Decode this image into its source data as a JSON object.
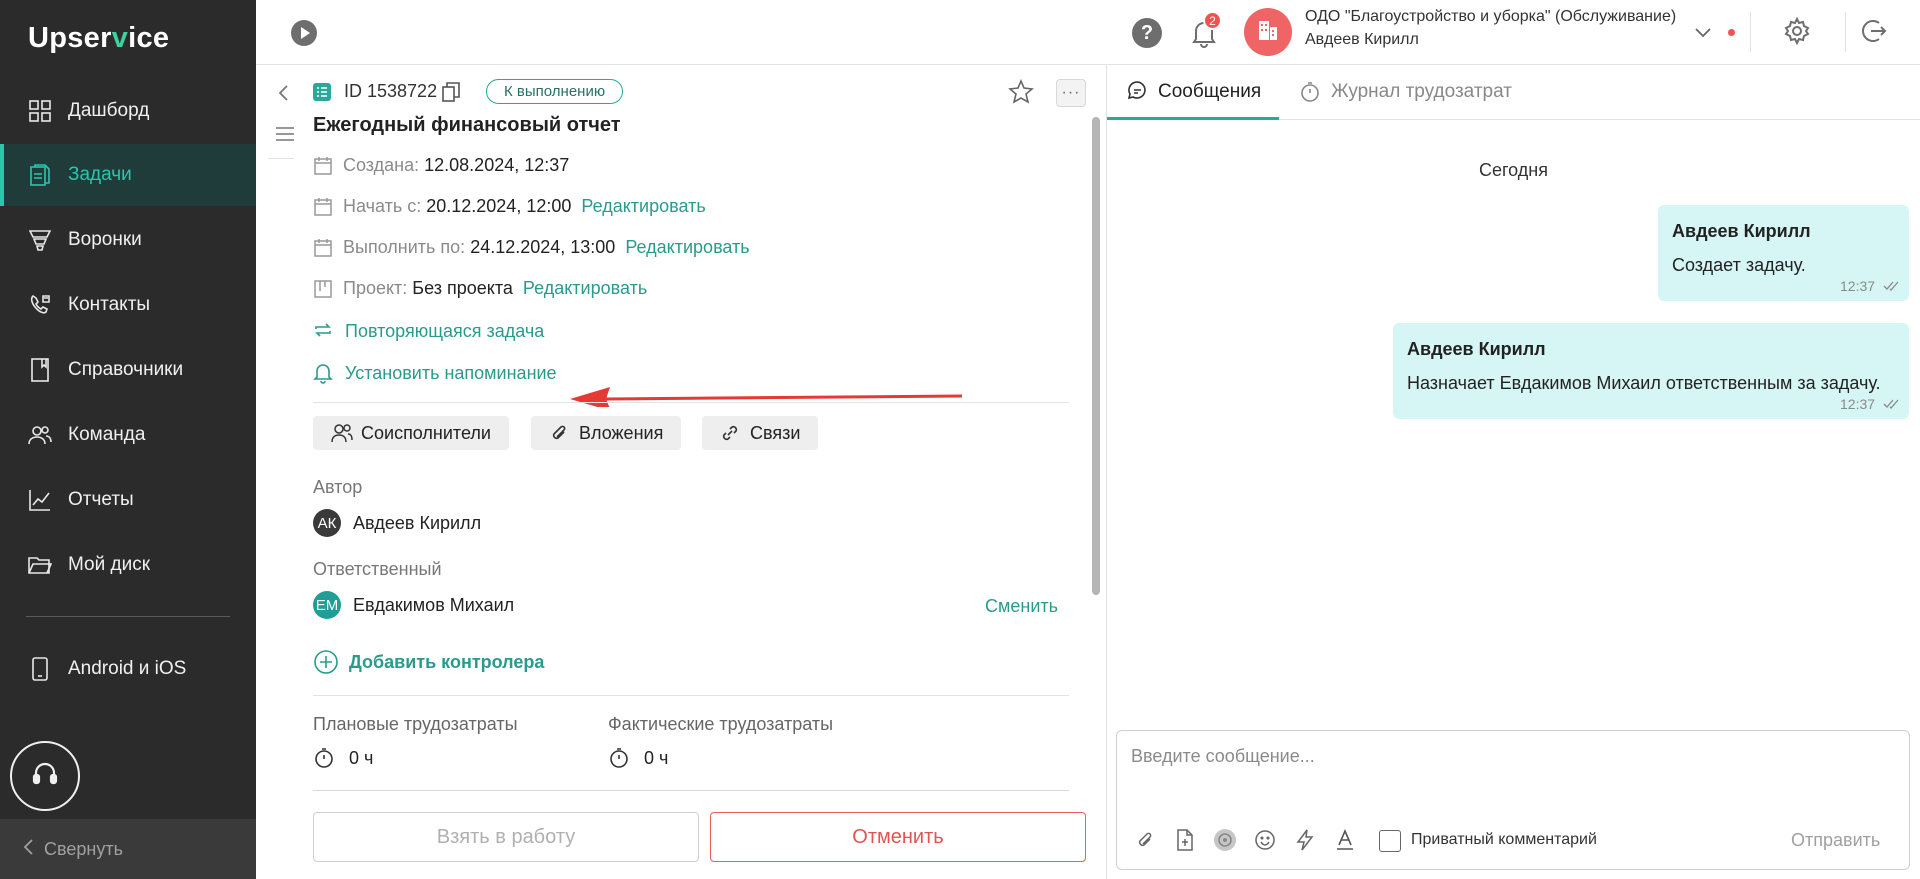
{
  "app": {
    "logo_left": "Upser",
    "logo_v": "v",
    "logo_right": "ice"
  },
  "sidebar": {
    "items": [
      {
        "label": "Дашборд",
        "icon": "grid-icon",
        "active": false
      },
      {
        "label": "Задачи",
        "icon": "clipboard-icon",
        "active": true
      },
      {
        "label": "Воронки",
        "icon": "funnel-icon",
        "active": false
      },
      {
        "label": "Контакты",
        "icon": "phone-book-icon",
        "active": false
      },
      {
        "label": "Справочники",
        "icon": "book-icon",
        "active": false
      },
      {
        "label": "Команда",
        "icon": "team-icon",
        "active": false
      },
      {
        "label": "Отчеты",
        "icon": "chart-icon",
        "active": false
      },
      {
        "label": "Мой диск",
        "icon": "folder-icon",
        "active": false
      }
    ],
    "mobile_label": "Android и iOS",
    "collapse_label": "Свернуть"
  },
  "topbar": {
    "notifications_count": "2",
    "org_name": "ОДО \"Благоустройство и уборка\" (Обслуживание)",
    "user_name": "Авдеев Кирилл"
  },
  "task": {
    "id": "ID 1538722",
    "status": "К выполнению",
    "title": "Ежегодный финансовый отчет",
    "created_label": "Создана:",
    "created_value": "12.08.2024, 12:37",
    "start_label": "Начать с:",
    "start_value": "20.12.2024, 12:00",
    "due_label": "Выполнить по:",
    "due_value": "24.12.2024, 13:00",
    "project_label": "Проект:",
    "project_value": "Без проекта",
    "edit_label": "Редактировать",
    "recurring_label": "Повторяющаяся задача",
    "reminder_label": "Установить напоминание",
    "chips": {
      "coexecutors": "Соисполнители",
      "attachments": "Вложения",
      "links": "Связи"
    },
    "author_label": "Автор",
    "author_initials": "АК",
    "author_name": "Авдеев Кирилл",
    "responsible_label": "Ответственный",
    "responsible_initials": "ЕМ",
    "responsible_name": "Евдакимов Михаил",
    "change_label": "Сменить",
    "add_controller_label": "Добавить контролера",
    "planned_label": "Плановые трудозатраты",
    "planned_value": "0 ч",
    "actual_label": "Фактические трудозатраты",
    "actual_value": "0 ч",
    "take_button": "Взять в работу",
    "cancel_button": "Отменить"
  },
  "chat": {
    "tab_messages": "Сообщения",
    "tab_log": "Журнал трудозатрат",
    "day_label": "Сегодня",
    "messages": [
      {
        "author": "Авдеев Кирилл",
        "text": "Создает задачу.",
        "time": "12:37"
      },
      {
        "author": "Авдеев Кирилл",
        "text": "Назначает Евдакимов Михаил ответственным за задачу.",
        "time": "12:37"
      }
    ],
    "input_placeholder": "Введите сообщение...",
    "private_label": "Приватный комментарий",
    "send_label": "Отправить"
  },
  "colors": {
    "accent": "#2aa89a",
    "sidebar_bg": "#2b2b2b",
    "danger": "#e05454",
    "bubble_bg": "#d6f6f6",
    "annotation_arrow": "#e53935"
  }
}
